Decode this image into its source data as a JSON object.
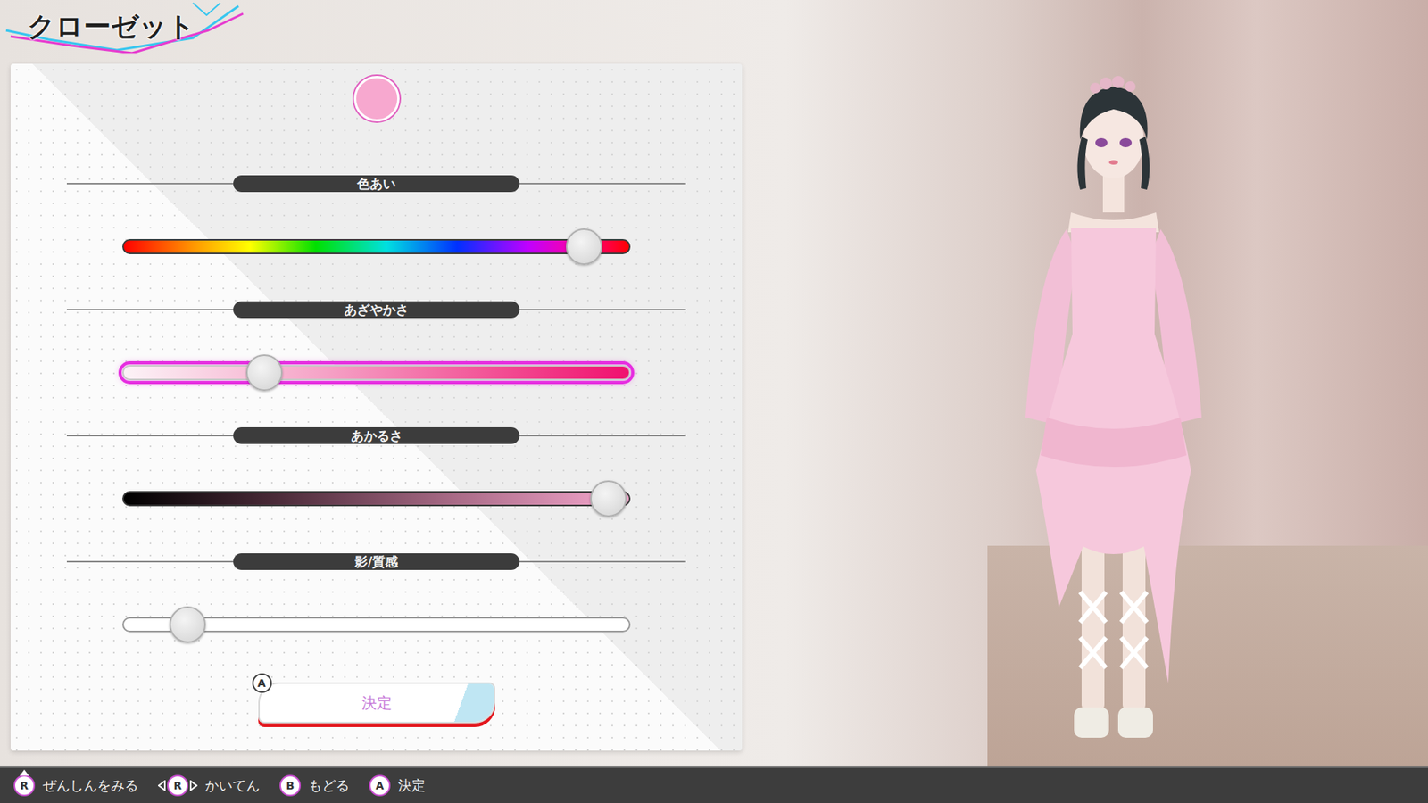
{
  "screen": {
    "title": "クローゼット"
  },
  "color_preview": {
    "color": "#f7a8cf"
  },
  "sliders": [
    {
      "label": "色あい",
      "kind": "hue",
      "level": 0.912,
      "selected": false
    },
    {
      "label": "あざやかさ",
      "kind": "saturation",
      "level": 0.278,
      "selected": true
    },
    {
      "label": "あかるさ",
      "kind": "brightness",
      "level": 0.959,
      "selected": false
    },
    {
      "label": "影/質感",
      "kind": "plain",
      "level": 0.127,
      "selected": false
    }
  ],
  "confirm_button": {
    "label": "決定",
    "key": "A"
  },
  "hints": [
    {
      "key": "R",
      "label": "ぜんしんをみる",
      "kind": "stick-press"
    },
    {
      "key": "R",
      "label": "かいてん",
      "kind": "stick-tilt"
    },
    {
      "key": "B",
      "label": "もどる",
      "kind": "button"
    },
    {
      "key": "A",
      "label": "決定",
      "kind": "button"
    }
  ]
}
